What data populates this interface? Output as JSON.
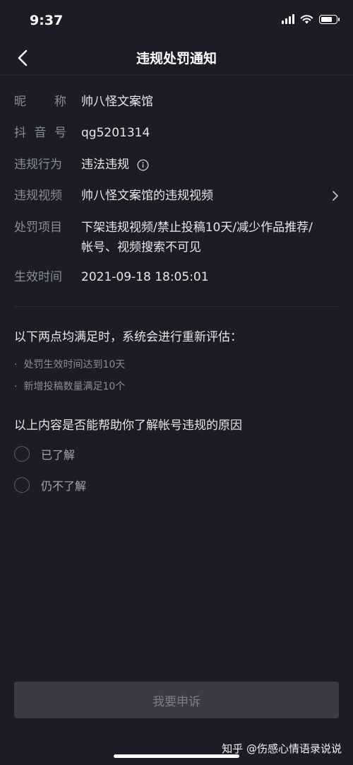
{
  "status_bar": {
    "time": "9:37"
  },
  "nav": {
    "title": "违规处罚通知"
  },
  "info": {
    "nickname": {
      "label_chars": [
        "昵",
        "称"
      ],
      "value": "帅八怪文案馆"
    },
    "douyin_id": {
      "label_chars": [
        "抖",
        "音",
        "号"
      ],
      "value": "qg5201314"
    },
    "violation_behavior": {
      "label": "违规行为",
      "value": "违法违规"
    },
    "violation_video": {
      "label": "违规视频",
      "value": "帅八怪文案馆的违规视频"
    },
    "penalty_items": {
      "label": "处罚项目",
      "value_line1": "下架违规视频/禁止投稿10天/减少作品推荐/",
      "value_line2": "帐号、视频搜索不可见"
    },
    "effective_time": {
      "label": "生效时间",
      "value": "2021-09-18 18:05:01"
    }
  },
  "reassess": {
    "title": "以下两点均满足时，系统会进行重新评估：",
    "bullets": [
      "处罚生效时间达到10天",
      "新增投稿数量满足10个"
    ],
    "bullet_symbol": "·"
  },
  "feedback": {
    "question": "以上内容是否能帮助你了解帐号违规的原因",
    "options": [
      "已了解",
      "仍不了解"
    ]
  },
  "appeal_button": {
    "label": "我要申诉"
  },
  "watermark": "知乎 @伤感心情语录说说",
  "colors": {
    "background": "#1b1c24",
    "label": "#8a8c96",
    "text": "#e6e7ea",
    "button": "#3a3b43"
  }
}
